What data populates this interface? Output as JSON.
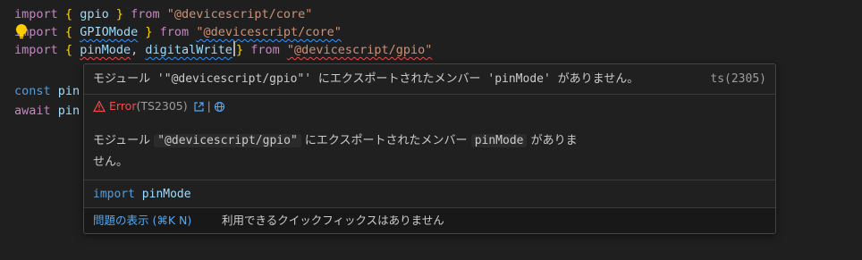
{
  "editor": {
    "line1": {
      "kw": "import",
      "open": "{",
      "name": "gpio",
      "close": "}",
      "from": "from",
      "module": "\"@devicescript/core\""
    },
    "line2": {
      "kw": "import",
      "open": "{",
      "name": "GPIOMode",
      "close": "}",
      "from": "from",
      "module": "\"@devicescript/core\""
    },
    "line3": {
      "kw": "import",
      "open": "{",
      "name1": "pinMode",
      "comma": ",",
      "name2": "digitalWrite",
      "close": "}",
      "from": "from",
      "module": "\"@devicescript/gpio\""
    },
    "line5": {
      "kw": "const",
      "rest": "pin"
    },
    "line6": {
      "kw": "await",
      "rest": "pin"
    }
  },
  "hover": {
    "headline": "モジュール '\"@devicescript/gpio\"' にエクスポートされたメンバー 'pinMode' がありません。",
    "headline_code": "ts(2305)",
    "error_label": "Error",
    "error_code": "(TS2305)",
    "icons": [
      "warning-icon",
      "external-link-icon",
      "globe-icon"
    ],
    "desc_pre": "モジュール",
    "desc_module": "\"@devicescript/gpio\"",
    "desc_mid": "にエクスポートされたメンバー",
    "desc_member": "pinMode",
    "desc_post": "がありま",
    "desc_line2": "せん。",
    "import_kw": "import",
    "import_name": "pinMode",
    "status_link": "問題の表示 (⌘K N)",
    "status_note": "利用できるクイックフィックスはありません"
  },
  "colors": {
    "keyword": "#c586c0",
    "identifier": "#9cdcfe",
    "string": "#ce9178",
    "bracket": "#ffd700",
    "error": "#f14c4c",
    "link": "#4daafc"
  }
}
